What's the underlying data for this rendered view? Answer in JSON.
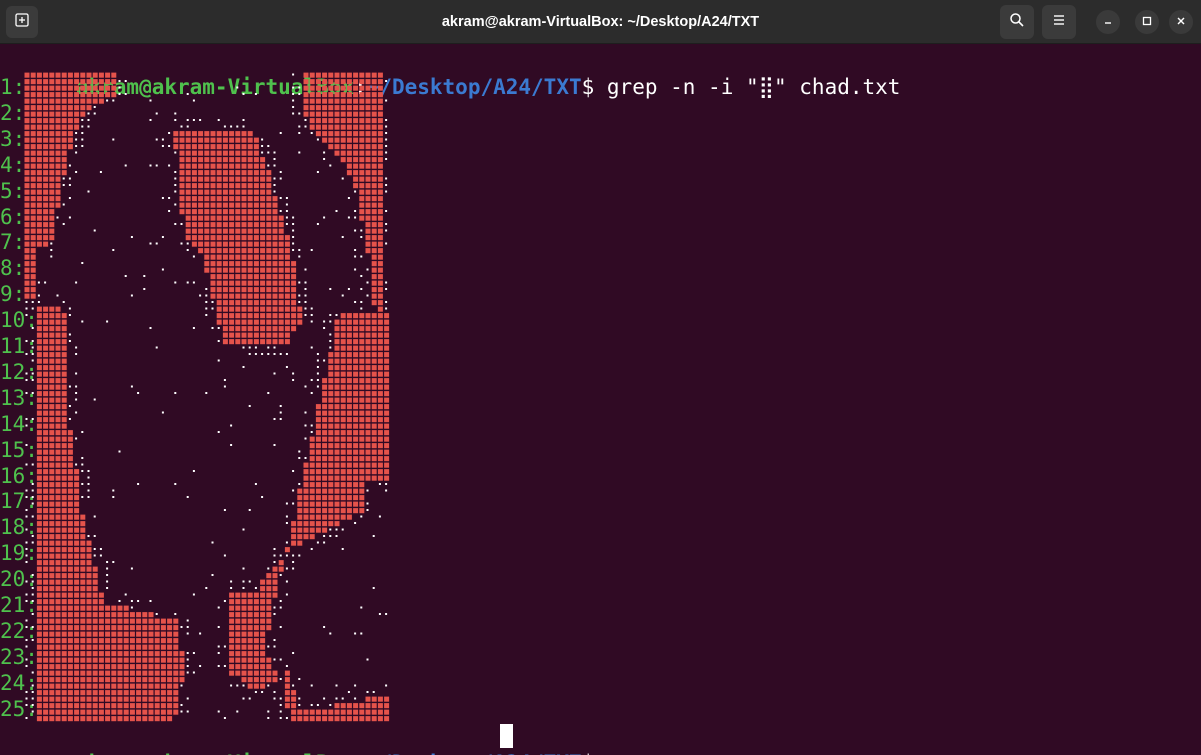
{
  "window": {
    "title": "akram@akram-VirtualBox: ~/Desktop/A24/TXT",
    "buttons": {
      "new_tab_icon": "new-tab-icon",
      "search_icon": "search-icon",
      "menu_icon": "hamburger-menu-icon",
      "minimize_icon": "minimize-icon",
      "maximize_icon": "maximize-icon",
      "close_icon": "close-icon"
    }
  },
  "terminal": {
    "prompt": {
      "user_host": "akram@akram-VirtualBox",
      "colon": ":",
      "path": "~/Desktop/A24/TXT",
      "dollar": "$"
    },
    "command": " grep -n -i \"⣿\" chad.txt",
    "line_numbers": [
      "1:",
      "2:",
      "3:",
      "4:",
      "5:",
      "6:",
      "7:",
      "8:",
      "9:",
      "10:",
      "11:",
      "12:",
      "13:",
      "14:",
      "15:",
      "16:",
      "17:",
      "18:",
      "19:",
      "20:",
      "21:",
      "22:",
      "23:",
      "24:",
      "25:"
    ],
    "art_description_icon": "braille-ascii-art",
    "colors": {
      "background": "#300a24",
      "match_highlight": "#e5534b",
      "prompt_user": "#4fc14d",
      "prompt_path": "#3b7ad1",
      "text": "#ffffff"
    }
  }
}
